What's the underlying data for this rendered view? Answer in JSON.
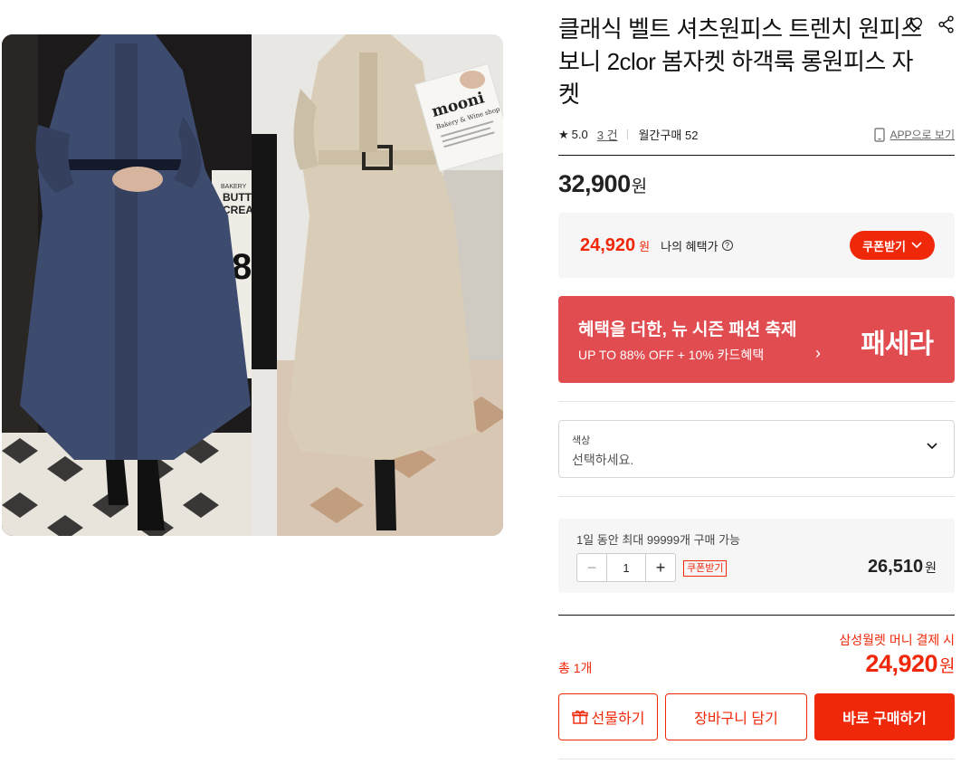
{
  "product": {
    "title": "클래식 벨트 셔츠원피스 트렌치 원피스 보니 2clor 봄자켓 하객룩 롱원피스 자켓",
    "image_alt": "product photo",
    "image_text": {
      "shop_bag_title": "mooni",
      "shop_bag_sub": "Bakery & Wine shop",
      "store_sign_1": "BAKERY",
      "store_sign_2": "BUTTE",
      "store_sign_3": "CREA",
      "store_sign_4": "8"
    }
  },
  "icons": {
    "wishlist": "heart-icon",
    "share": "share-icon",
    "app": "phone-icon",
    "star": "star-icon",
    "gift": "gift-icon",
    "chevron": "chevron-down-icon"
  },
  "meta": {
    "star": "★",
    "rating": "5.0",
    "reviews": "3 건",
    "monthly_sales": "월간구매 52",
    "app_link": "APP으로 보기"
  },
  "price": {
    "original": "32,900",
    "won": "원"
  },
  "benefit": {
    "price": "24,920",
    "won": "원",
    "label": "나의 혜택가",
    "help": "?",
    "coupon_button": "쿠폰받기"
  },
  "banner": {
    "headline": "혜택을 더한, 뉴 시즌 패션 축제",
    "sub": "UP TO 88% OFF + 10% 카드혜택",
    "arrow": "›",
    "logo": "패세라"
  },
  "option_select": {
    "label": "색상",
    "value": "선택하세요."
  },
  "quantity": {
    "limit_text": "1일 동안 최대 99999개 구매 가능",
    "minus": "−",
    "value": "1",
    "plus": "+",
    "coupon": "쿠폰받기",
    "price": "26,510",
    "won": "원"
  },
  "total": {
    "pay_note": "삼성월렛 머니 결제 시",
    "count": "총 1개",
    "price": "24,920",
    "won": "원"
  },
  "actions": {
    "gift": "선물하기",
    "cart": "장바구니 담기",
    "buy": "바로 구매하기"
  },
  "colors": {
    "accent": "#f0280a",
    "banner": "#e04c50"
  }
}
